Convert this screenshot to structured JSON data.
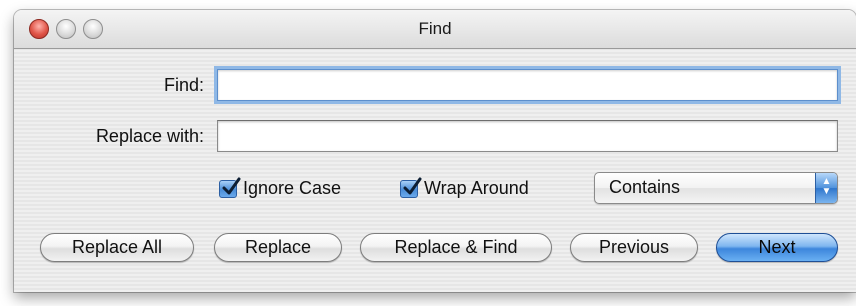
{
  "window": {
    "title": "Find"
  },
  "form": {
    "find_label": "Find:",
    "find_value": "",
    "replace_label": "Replace with:",
    "replace_value": ""
  },
  "options": {
    "ignore_case": {
      "label": "Ignore Case",
      "checked": true
    },
    "wrap_around": {
      "label": "Wrap Around",
      "checked": true
    },
    "match_mode": {
      "selected": "Contains"
    }
  },
  "buttons": {
    "replace_all": "Replace All",
    "replace": "Replace",
    "replace_and_find": "Replace & Find",
    "previous": "Previous",
    "next": "Next"
  },
  "icons": {
    "close": "close-icon",
    "minimize": "minimize-icon",
    "zoom": "zoom-icon",
    "checkmark": "checkmark-icon",
    "popup_arrows": "updown-arrows-icon"
  },
  "colors": {
    "accent": "#4b8ed8",
    "close_button": "#e05548",
    "focus_ring": "#8fb8e6"
  }
}
